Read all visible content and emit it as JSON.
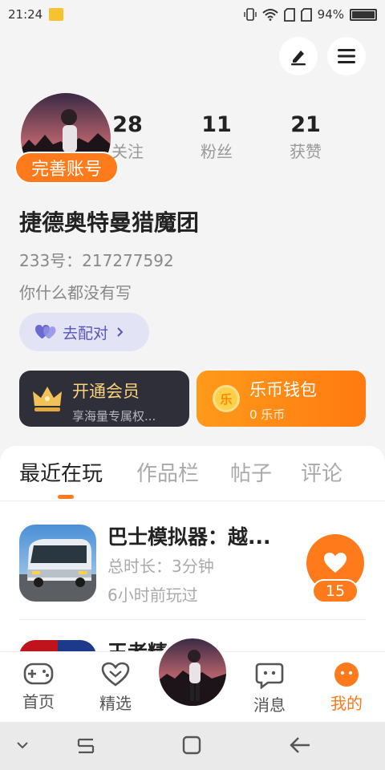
{
  "status_bar": {
    "time": "21:24",
    "battery": "94%",
    "battery_level": 0.94
  },
  "profile": {
    "complete_account_label": "完善账号",
    "stats": [
      {
        "value": "28",
        "label": "关注"
      },
      {
        "value": "11",
        "label": "粉丝"
      },
      {
        "value": "21",
        "label": "获赞"
      }
    ],
    "name": "捷德奥特曼猎魔团",
    "id_text": "233号：217277592",
    "bio": "你什么都没有写",
    "pair_label": "去配对"
  },
  "cards": {
    "vip": {
      "title": "开通会员",
      "subtitle": "享海量专属权..."
    },
    "wallet": {
      "icon_text": "乐",
      "title": "乐币钱包",
      "subtitle": "0 乐币"
    }
  },
  "tabs": [
    "最近在玩",
    "作品栏",
    "帖子",
    "评论"
  ],
  "recent_games": [
    {
      "title": "巴士模拟器：越...",
      "duration": "总时长：3分钟",
      "last_played": "6小时前玩过",
      "likes": "15"
    },
    {
      "title": "王者精..."
    }
  ],
  "bottom_nav": [
    "首页",
    "精选",
    "消息",
    "我的"
  ],
  "colors": {
    "accent": "#ff7a1a",
    "vip_bg": "#2e2f38",
    "pair_text": "#5656b8"
  }
}
